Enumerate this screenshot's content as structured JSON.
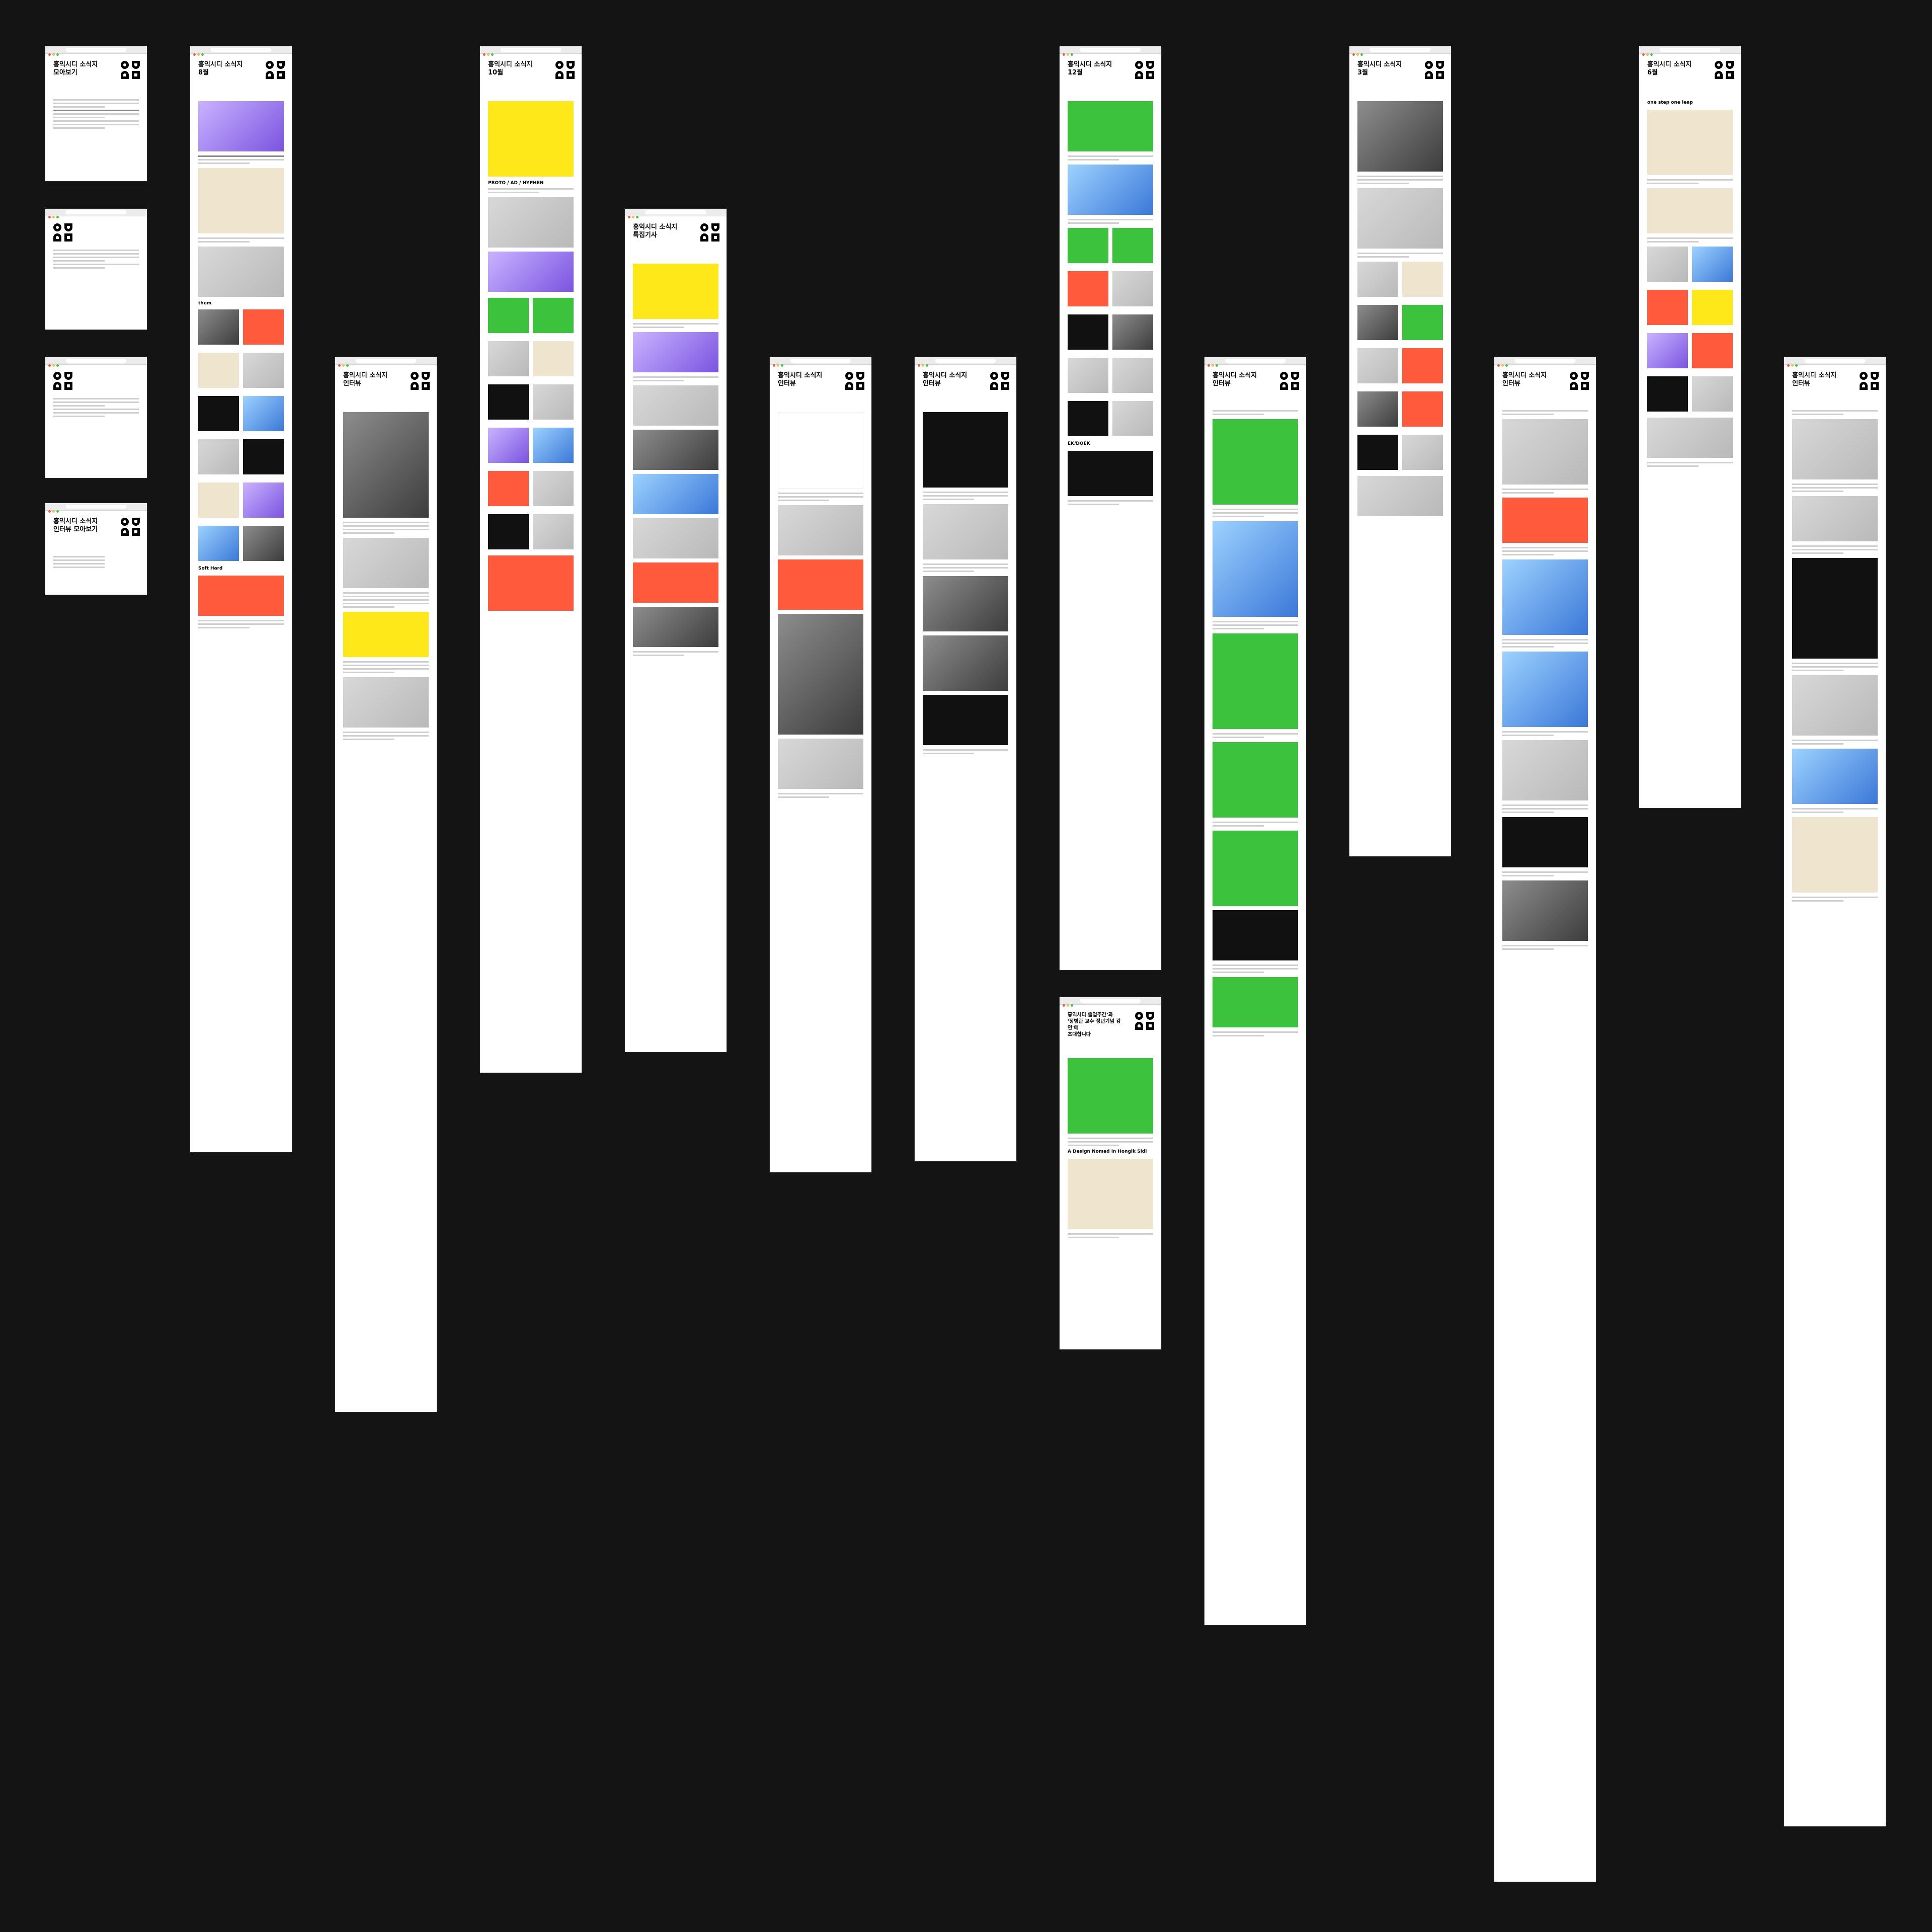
{
  "windows": [
    {
      "id": "w1",
      "title": "홍익시디 소식지\n모아보기"
    },
    {
      "id": "w2",
      "title": ""
    },
    {
      "id": "w3",
      "title": ""
    },
    {
      "id": "w4",
      "title": "홍익시디 소식지\n인터뷰 모아보기"
    },
    {
      "id": "w5",
      "title": "홍익시디 소식지\n8월"
    },
    {
      "id": "w6",
      "title": "홍익시디 소식지\n인터뷰"
    },
    {
      "id": "w7",
      "title": "홍익시디 소식지\n10월"
    },
    {
      "id": "w8",
      "title": "홍익시디 소식지\n특집기사"
    },
    {
      "id": "w9",
      "title": "홍익시디 소식지\n인터뷰"
    },
    {
      "id": "w10",
      "title": "홍익시디 소식지\n인터뷰"
    },
    {
      "id": "w11",
      "title": "홍익시디 소식지\n12월"
    },
    {
      "id": "w12",
      "title": "홍익시디 졸업주간’과\n'정병관 교수 정년기념 강연'에\n초대합니다"
    },
    {
      "id": "w13",
      "title": "홍익시디 소식지\n인터뷰"
    },
    {
      "id": "w14",
      "title": "홍익시디 소식지\n3월"
    },
    {
      "id": "w15",
      "title": "홍익시디 소식지\n인터뷰"
    },
    {
      "id": "w16",
      "title": "홍익시디 소식지\n6월"
    },
    {
      "id": "w17",
      "title": "홍익시디 소식지\n인터뷰"
    }
  ],
  "headings": {
    "w7_hero": "PROTO / AD / HYPHEN",
    "w12_card": "A Design Nomad in Hongik Sidi",
    "w16_card": "one step one leap",
    "w6_card": "them",
    "w5_card": "Soft Hard",
    "w11_card": "EK/DOEK"
  }
}
